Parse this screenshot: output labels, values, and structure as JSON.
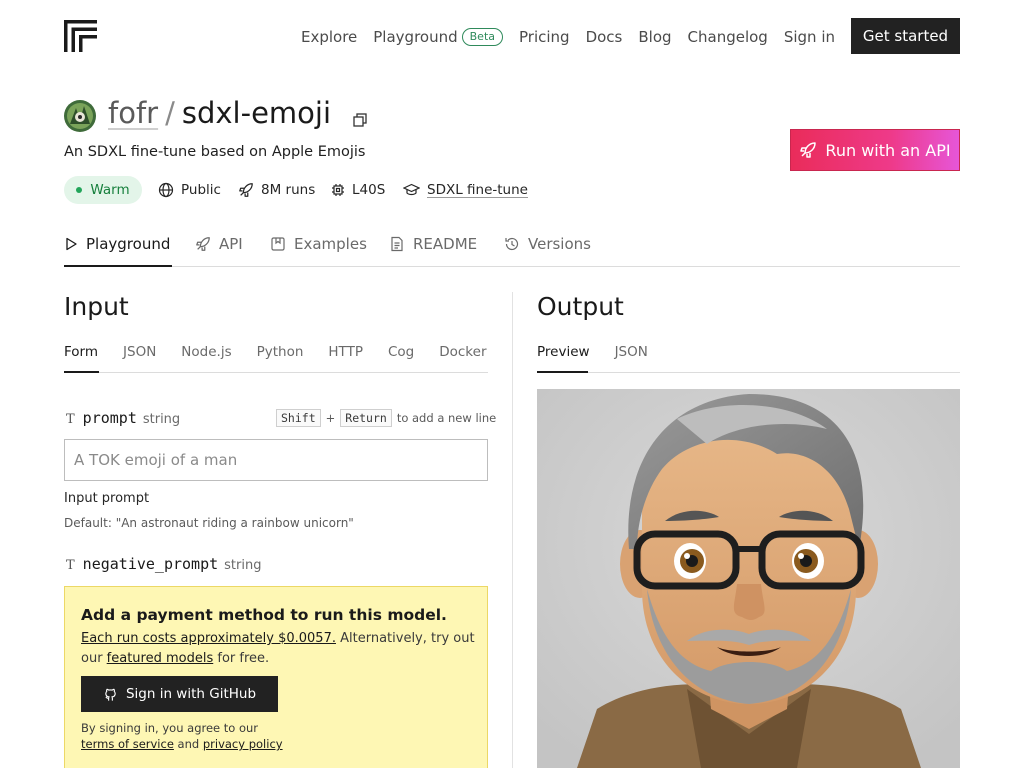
{
  "header": {
    "nav": [
      {
        "label": "Explore"
      },
      {
        "label": "Playground",
        "badge": "Beta"
      },
      {
        "label": "Pricing"
      },
      {
        "label": "Docs"
      },
      {
        "label": "Blog"
      },
      {
        "label": "Changelog"
      },
      {
        "label": "Sign in"
      }
    ],
    "cta": "Get started"
  },
  "model": {
    "owner": "fofr",
    "separator": "/",
    "name": "sdxl-emoji",
    "description": "An SDXL fine-tune based on Apple Emojis",
    "run_api_label": "Run with an API",
    "status": "Warm",
    "visibility": "Public",
    "runs": "8M runs",
    "hardware": "L40S",
    "base_model": "SDXL fine-tune"
  },
  "tabs": [
    {
      "label": "Playground",
      "icon": "play-icon"
    },
    {
      "label": "API",
      "icon": "rocket-icon"
    },
    {
      "label": "Examples",
      "icon": "bookmark-icon"
    },
    {
      "label": "README",
      "icon": "document-icon"
    },
    {
      "label": "Versions",
      "icon": "history-icon"
    }
  ],
  "input": {
    "title": "Input",
    "subtabs": [
      "Form",
      "JSON",
      "Node.js",
      "Python",
      "HTTP",
      "Cog",
      "Docker"
    ],
    "params": [
      {
        "type_glyph": "T",
        "name": "prompt",
        "type": "string",
        "value": "",
        "placeholder": "A TOK emoji of a man",
        "label": "Input prompt",
        "default": "Default: \"An astronaut riding a rainbow unicorn\""
      },
      {
        "type_glyph": "T",
        "name": "negative_prompt",
        "type": "string"
      }
    ],
    "hint": {
      "key1": "Shift",
      "plus": "+",
      "key2": "Return",
      "text": "to add a new line"
    }
  },
  "payment": {
    "title": "Add a payment method to run this model.",
    "cost_link": "Each run costs approximately $0.0057.",
    "text1": " Alternatively, try out our ",
    "featured_link": "featured models",
    "text2": " for free.",
    "github_button": "Sign in with GitHub",
    "terms_prefix": "By signing in, you agree to our",
    "terms_link": "terms of service",
    "terms_and": " and ",
    "privacy_link": "privacy policy"
  },
  "output": {
    "title": "Output",
    "subtabs": [
      "Preview",
      "JSON"
    ]
  },
  "colors": {
    "accent_gradient_start": "#ea2c5a",
    "accent_gradient_end": "#e656d8",
    "warm_bg": "#e3f5e9",
    "warm_text": "#17803d",
    "payment_bg": "#fef7b4",
    "dark_button": "#222222"
  }
}
